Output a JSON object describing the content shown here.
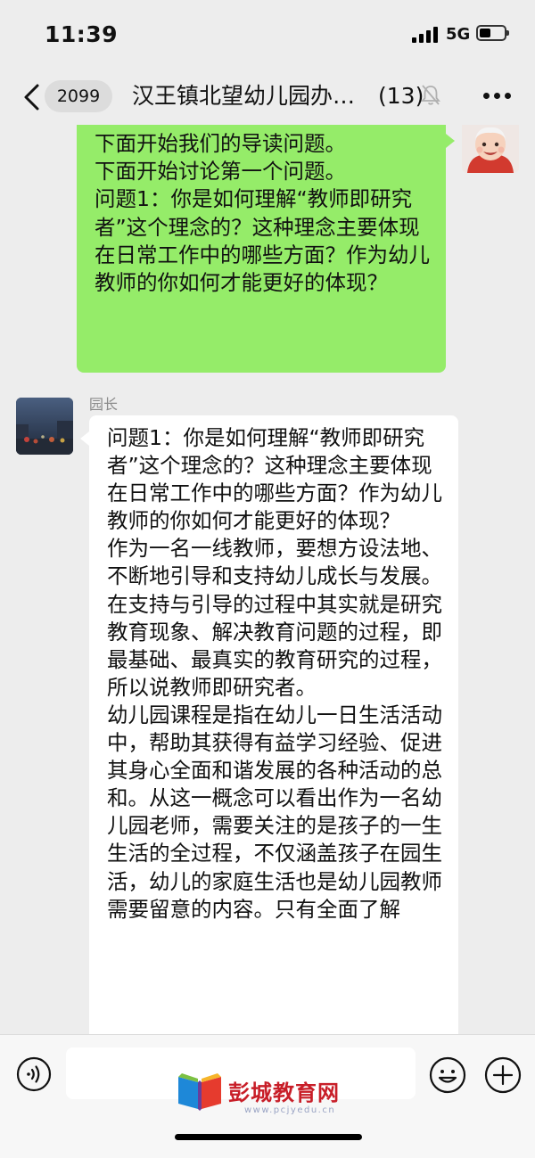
{
  "status_bar": {
    "time": "11:39",
    "network": "5G",
    "battery_level": 0.45
  },
  "nav": {
    "unread_count": "2099",
    "title": "汉王镇北望幼儿园办…",
    "member_count": "(13)",
    "icons": {
      "back": "chevron-left-icon",
      "mute": "bell-muted-icon",
      "more": "more-dots-icon"
    }
  },
  "messages": [
    {
      "sender": "me",
      "text": "下面开始我们的导读问题。\n下面开始讨论第一个问题。\n问题1：你是如何理解“教师即研究者”这个理念的？这种理念主要体现在日常工作中的哪些方面？作为幼儿教师的你如何才能更好的体现？",
      "bubble_color": "#95ec69"
    },
    {
      "sender_name": "园长",
      "text": "问题1：你是如何理解“教师即研究者”这个理念的？这种理念主要体现在日常工作中的哪些方面？作为幼儿教师的你如何才能更好的体现？\n作为一名一线教师，要想方设法地、不断地引导和支持幼儿成长与发展。在支持与引导的过程中其实就是研究教育现象、解决教育问题的过程，即最基础、最真实的教育研究的过程，所以说教师即研究者。\n幼儿园课程是指在幼儿一日生活活动中，帮助其获得有益学习经验、促进其身心全面和谐发展的各种活动的总和。从这一概念可以看出作为一名幼儿园老师，需要关注的是孩子的一生生活的全过程，不仅涵盖孩子在园生活，幼儿的家庭生活也是幼儿园教师需要留意的内容。只有全面了解",
      "bubble_color": "#ffffff"
    }
  ],
  "input_bar": {
    "placeholder": "",
    "icons": {
      "voice": "voice-icon",
      "emoji": "emoji-icon",
      "plus": "plus-icon"
    }
  },
  "watermark": {
    "text": "彭城教育网",
    "url": "www.pcjyedu.cn"
  },
  "colors": {
    "background": "#ededed",
    "my_bubble": "#95ec69",
    "watermark_red": "#c81e28"
  }
}
